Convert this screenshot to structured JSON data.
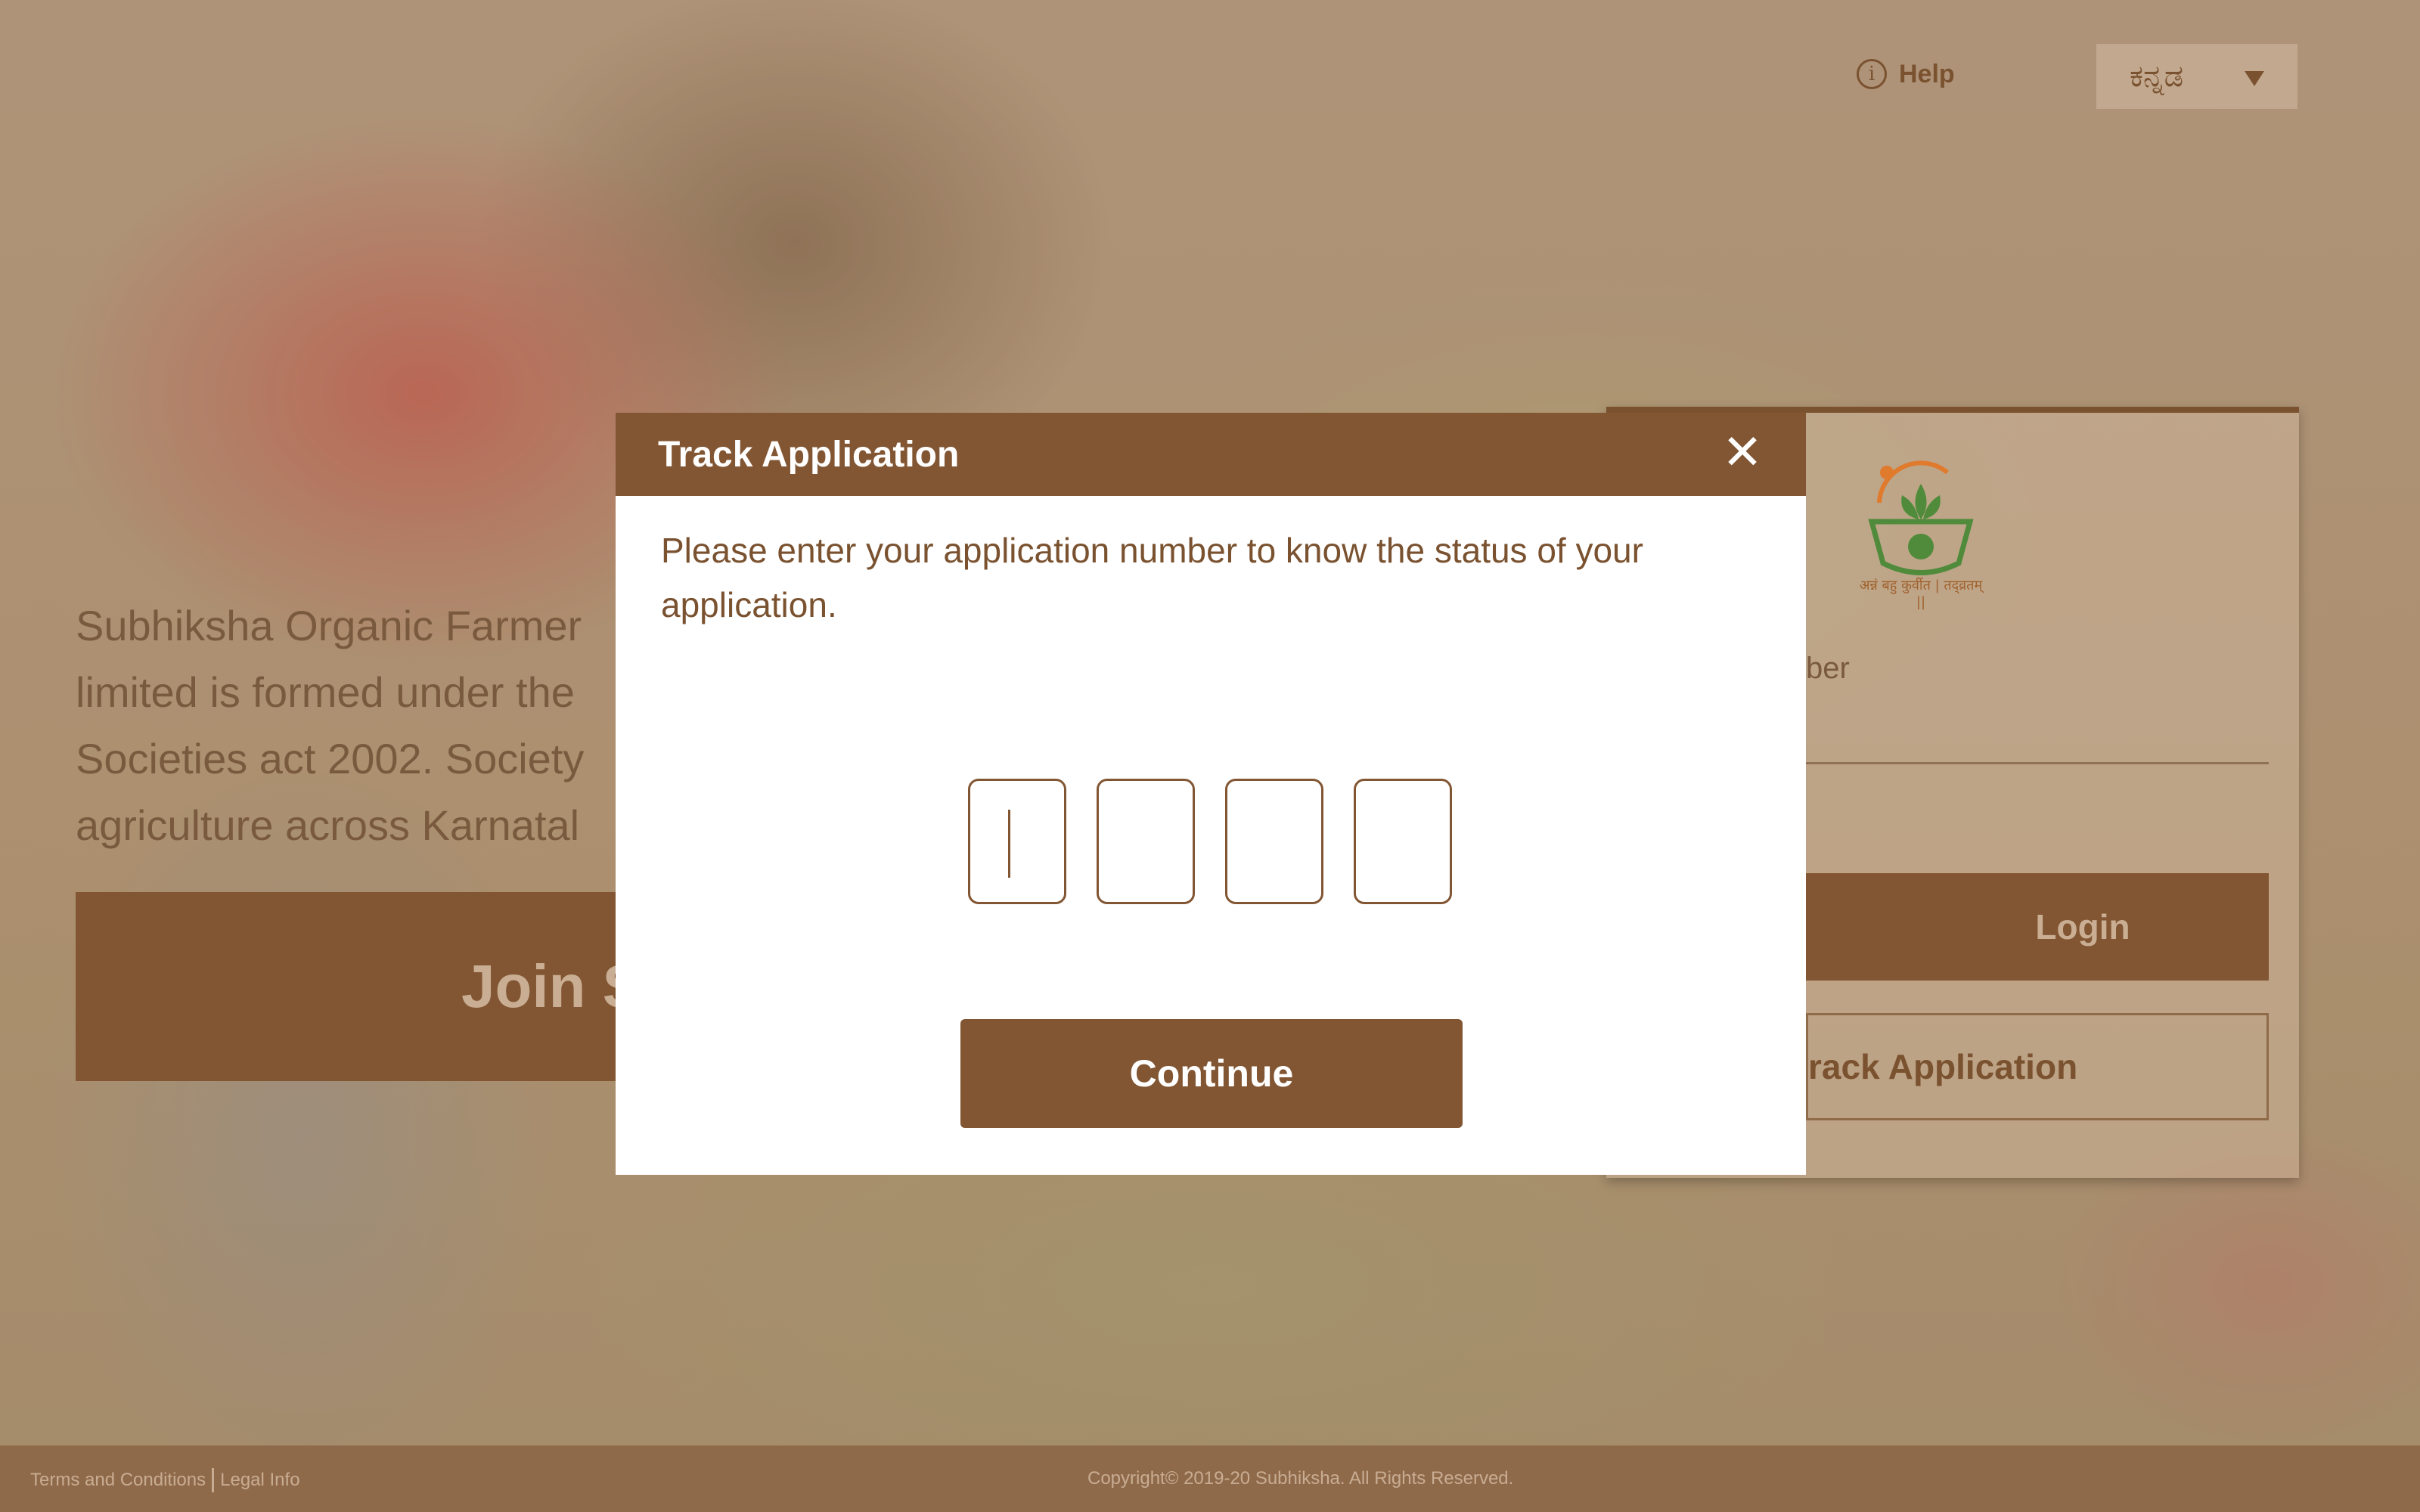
{
  "header": {
    "help_label": "Help",
    "help_icon": "i",
    "language": "ಕನ್ನಡ"
  },
  "intro": {
    "text": "Subhiksha Organic Farmer\nlimited is formed under the\nSocieties act 2002. Society\nagriculture across Karnatal",
    "join_label": "Join S"
  },
  "login_card": {
    "logo_tagline": "अन्नं बहु कुर्वीत | तद्व्रतम् ||",
    "field_label": "ber",
    "login_label": "Login",
    "track_label": "rack Application"
  },
  "modal": {
    "title": "Track Application",
    "close_symbol": "✕",
    "message": "Please enter your application number to know the status of your application.",
    "digits": [
      "",
      "",
      "",
      ""
    ],
    "continue_label": "Continue"
  },
  "footer": {
    "terms_label": "Terms and Conditions",
    "legal_label": "Legal Info",
    "copyright": "Copyright© 2019-20 Subhiksha. All Rights Reserved."
  },
  "colors": {
    "brand_brown": "#825633",
    "text_brown": "#7a5230",
    "white": "#ffffff"
  }
}
